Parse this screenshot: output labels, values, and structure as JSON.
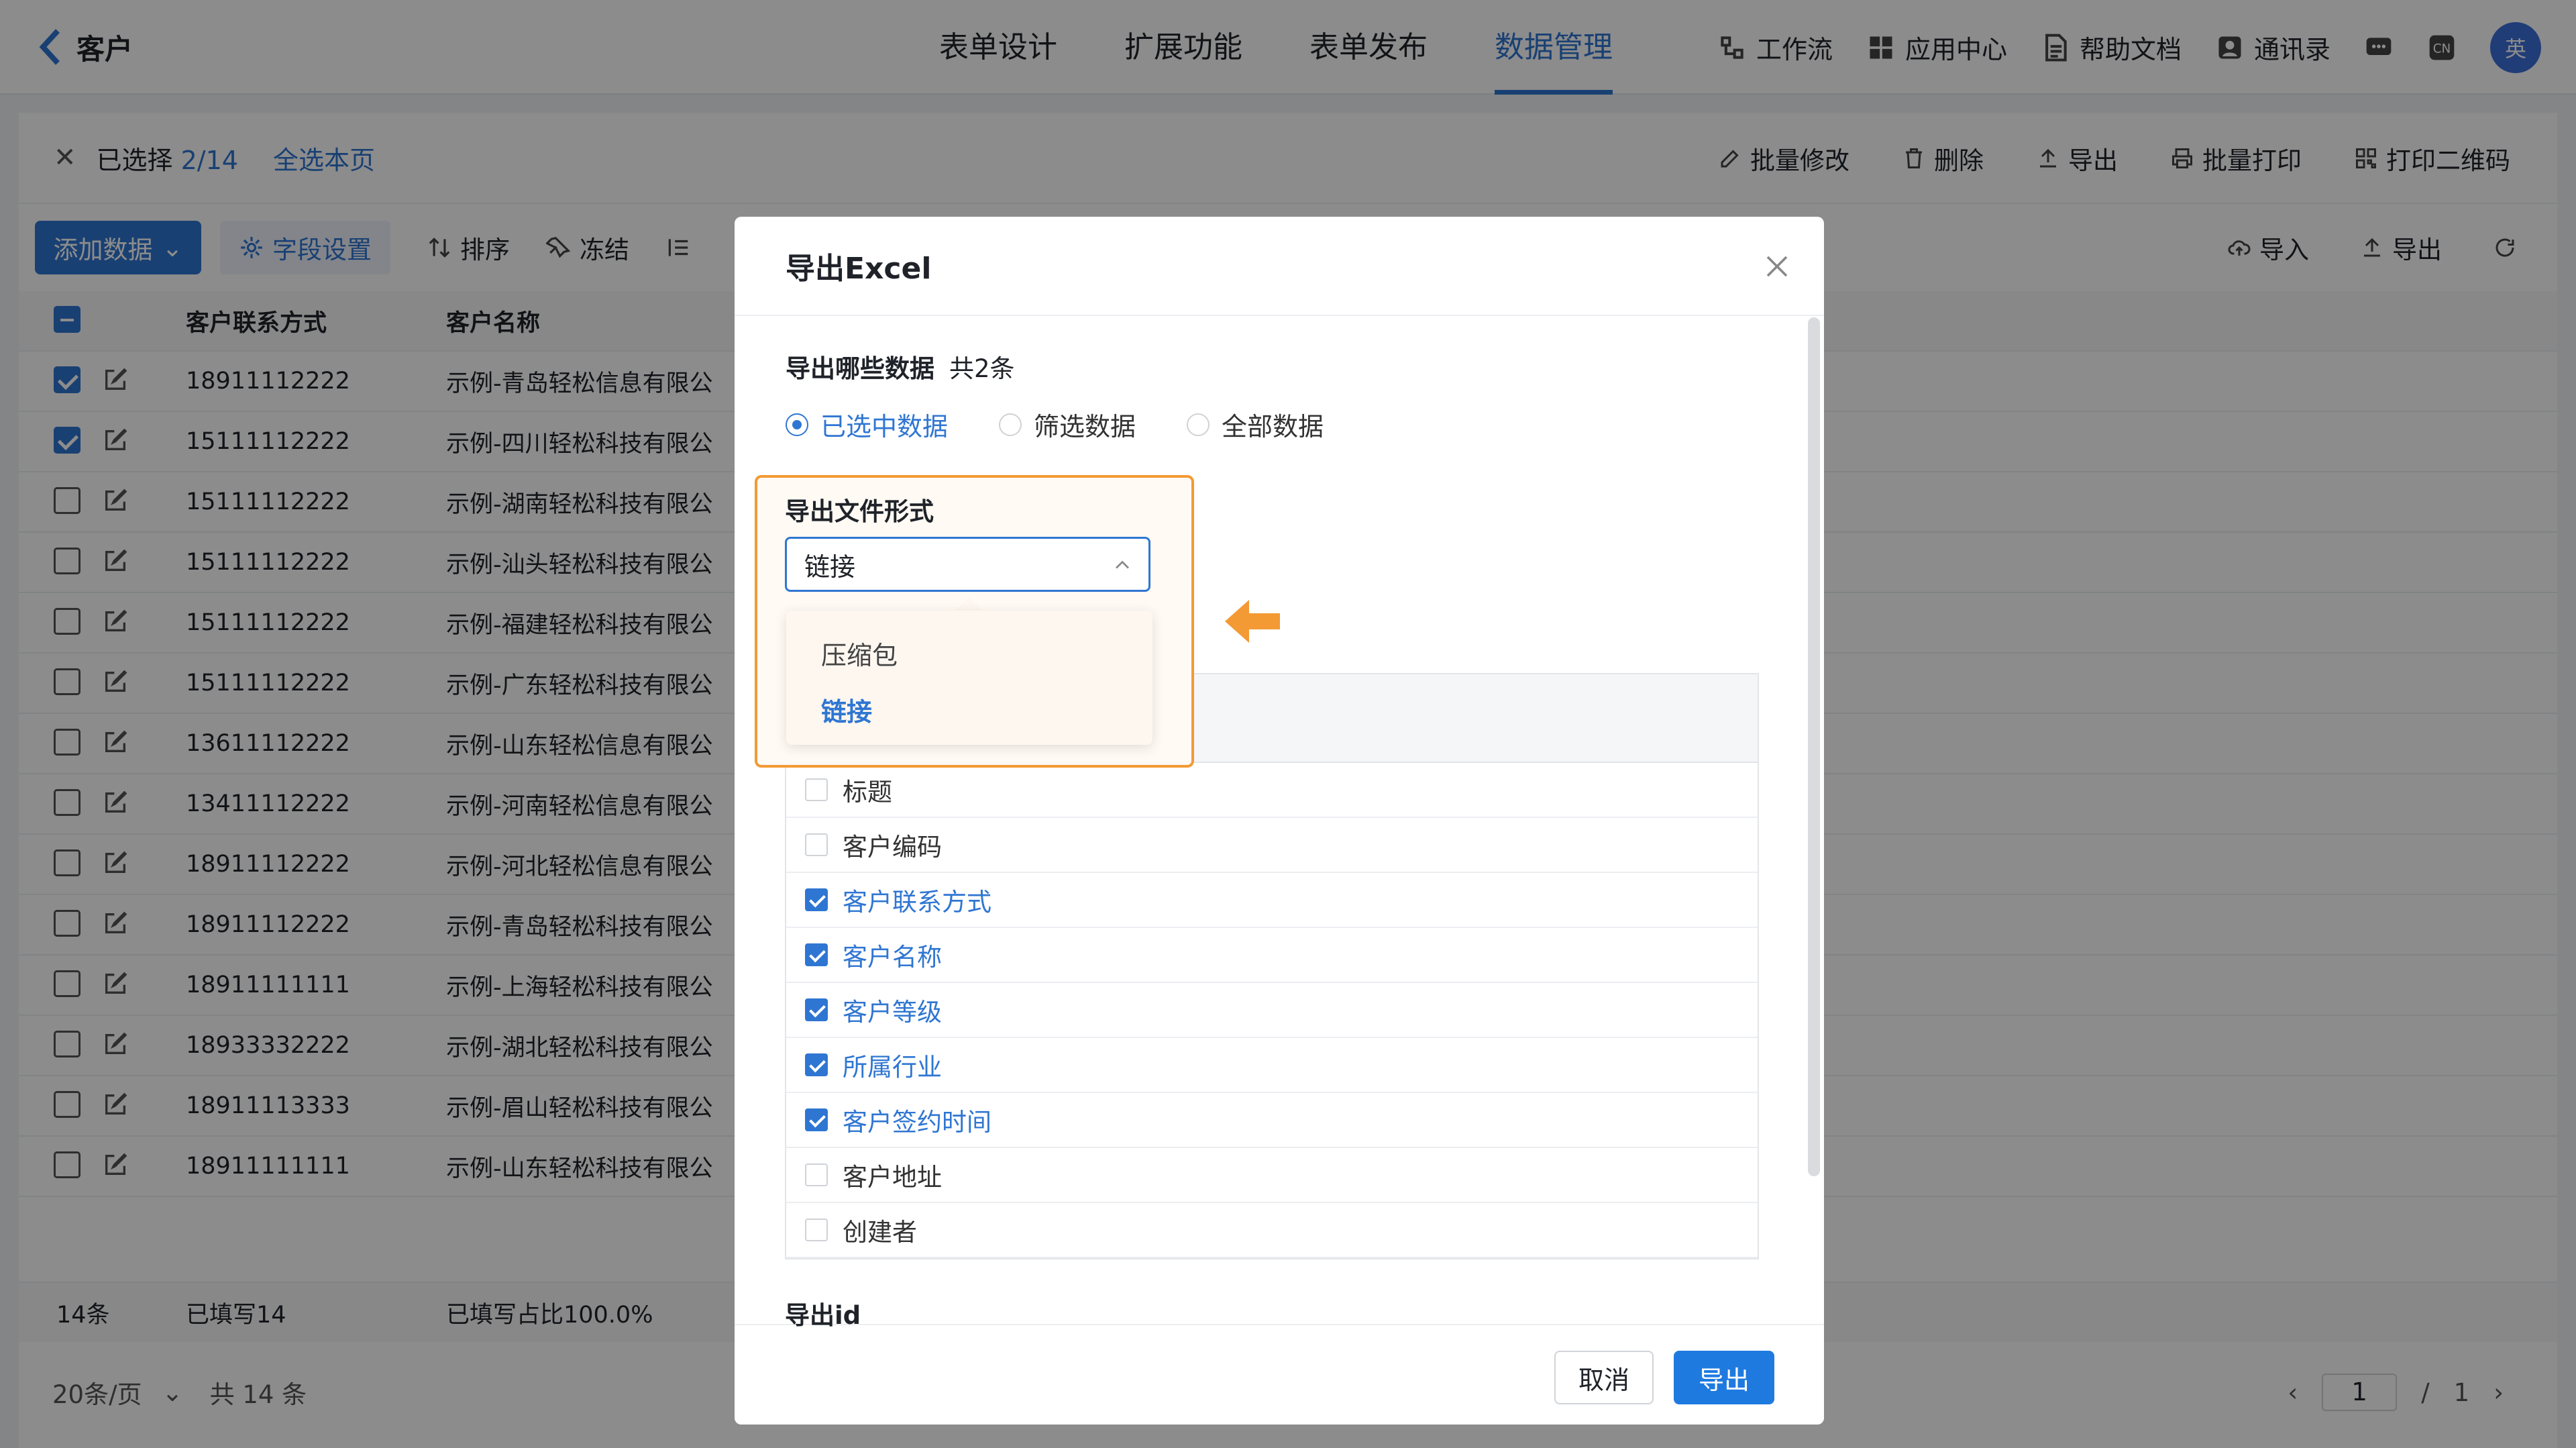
{
  "header": {
    "back_label": "客户",
    "tabs": [
      "表单设计",
      "扩展功能",
      "表单发布",
      "数据管理"
    ],
    "active_tab": "数据管理",
    "tools": [
      "工作流",
      "应用中心",
      "帮助文档",
      "通讯录"
    ],
    "lang_badge": "CN",
    "avatar_text": "英"
  },
  "selection_bar": {
    "selected_prefix": "已选择",
    "selected_count": "2/14",
    "select_all_page": "全选本页",
    "actions": [
      "批量修改",
      "删除",
      "导出",
      "批量打印",
      "打印二维码"
    ]
  },
  "toolbar": {
    "add_data": "添加数据",
    "field_settings": "字段设置",
    "sort": "排序",
    "freeze": "冻结",
    "import": "导入",
    "export": "导出"
  },
  "table": {
    "columns": [
      "客户联系方式",
      "客户名称"
    ],
    "rows": [
      {
        "phone": "18911112222",
        "name": "示例-青岛轻松信息有限公",
        "checked": true
      },
      {
        "phone": "15111112222",
        "name": "示例-四川轻松科技有限公",
        "checked": true
      },
      {
        "phone": "15111112222",
        "name": "示例-湖南轻松科技有限公",
        "checked": false
      },
      {
        "phone": "15111112222",
        "name": "示例-汕头轻松科技有限公",
        "checked": false
      },
      {
        "phone": "15111112222",
        "name": "示例-福建轻松科技有限公",
        "checked": false
      },
      {
        "phone": "15111112222",
        "name": "示例-广东轻松科技有限公",
        "checked": false
      },
      {
        "phone": "13611112222",
        "name": "示例-山东轻松信息有限公",
        "checked": false
      },
      {
        "phone": "13411112222",
        "name": "示例-河南轻松信息有限公",
        "checked": false
      },
      {
        "phone": "18911112222",
        "name": "示例-河北轻松信息有限公",
        "checked": false
      },
      {
        "phone": "18911112222",
        "name": "示例-青岛轻松科技有限公",
        "checked": false
      },
      {
        "phone": "18911111111",
        "name": "示例-上海轻松科技有限公",
        "checked": false
      },
      {
        "phone": "18933332222",
        "name": "示例-湖北轻松科技有限公",
        "checked": false
      },
      {
        "phone": "18911113333",
        "name": "示例-眉山轻松科技有限公",
        "checked": false
      },
      {
        "phone": "18911111111",
        "name": "示例-山东轻松科技有限公",
        "checked": false
      }
    ],
    "footer": {
      "count": "14条",
      "filled": "已填写14",
      "ratio": "已填写占比100.0%"
    }
  },
  "pagination": {
    "page_size": "20条/页",
    "total": "共 14 条",
    "current": "1",
    "separator": "/",
    "pages": "1"
  },
  "modal": {
    "title": "导出Excel",
    "which_data_label": "导出哪些数据",
    "total_text": "共2条",
    "radio_options": [
      "已选中数据",
      "筛选数据",
      "全部数据"
    ],
    "radio_selected": "已选中数据",
    "file_format_label": "导出文件形式",
    "file_format_value": "链接",
    "dropdown_options": [
      "压缩包",
      "链接"
    ],
    "dropdown_selected": "链接",
    "fields": [
      {
        "label": "标题",
        "checked": false
      },
      {
        "label": "客户编码",
        "checked": false
      },
      {
        "label": "客户联系方式",
        "checked": true
      },
      {
        "label": "客户名称",
        "checked": true
      },
      {
        "label": "客户等级",
        "checked": true
      },
      {
        "label": "所属行业",
        "checked": true
      },
      {
        "label": "客户签约时间",
        "checked": true
      },
      {
        "label": "客户地址",
        "checked": false
      },
      {
        "label": "创建者",
        "checked": false
      }
    ],
    "export_id_label": "导出id",
    "cancel_label": "取消",
    "export_label": "导出"
  },
  "colors": {
    "accent": "#2f76d2",
    "export_button": "#1f7ae0",
    "highlight_border": "#f39a34"
  }
}
